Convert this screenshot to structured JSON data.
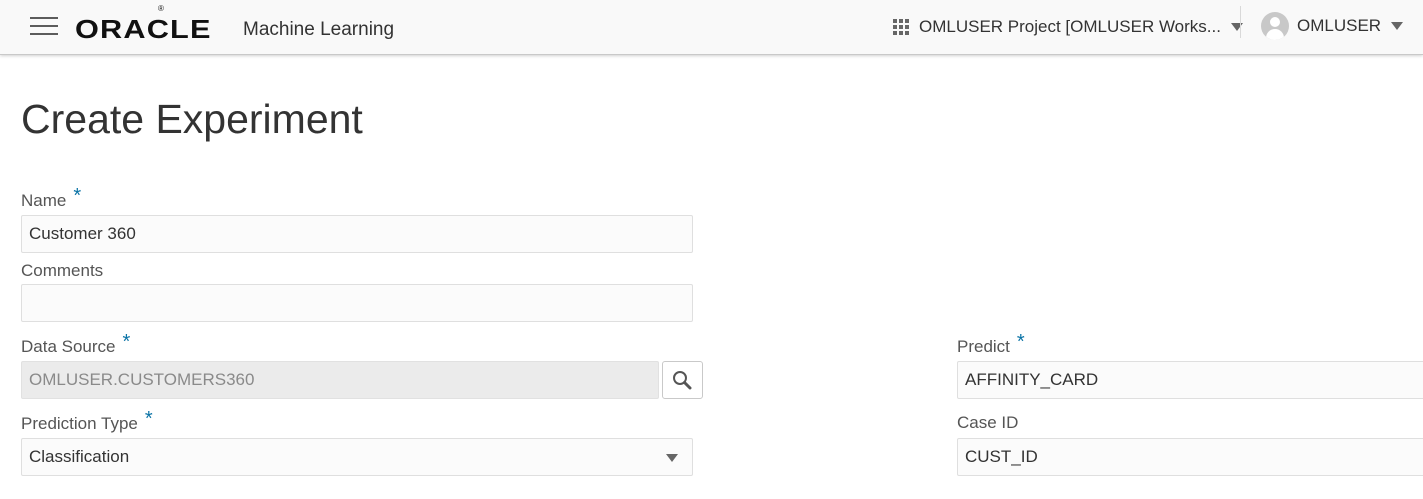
{
  "header": {
    "brand": "ORACLE",
    "brand_mark": "®",
    "product": "Machine Learning",
    "project_selector": "OMLUSER Project [OMLUSER Works...",
    "user": "OMLUSER"
  },
  "page": {
    "title": "Create Experiment"
  },
  "form": {
    "name": {
      "label": "Name",
      "required": "*",
      "value": "Customer 360"
    },
    "comments": {
      "label": "Comments",
      "value": ""
    },
    "data_source": {
      "label": "Data Source",
      "required": "*",
      "value": "OMLUSER.CUSTOMERS360"
    },
    "prediction_type": {
      "label": "Prediction Type",
      "required": "*",
      "value": "Classification"
    },
    "predict": {
      "label": "Predict",
      "required": "*",
      "value": "AFFINITY_CARD"
    },
    "case_id": {
      "label": "Case ID",
      "value": "CUST_ID"
    }
  },
  "icons": {
    "menu": "hamburger-icon",
    "project": "grid-icon",
    "user": "avatar-icon",
    "search": "search-icon",
    "dropdown": "chevron-down-icon"
  },
  "colors": {
    "required_marker": "#0a73a6",
    "header_background": "#f9f9f9",
    "readonly_field": "#ebebeb"
  }
}
